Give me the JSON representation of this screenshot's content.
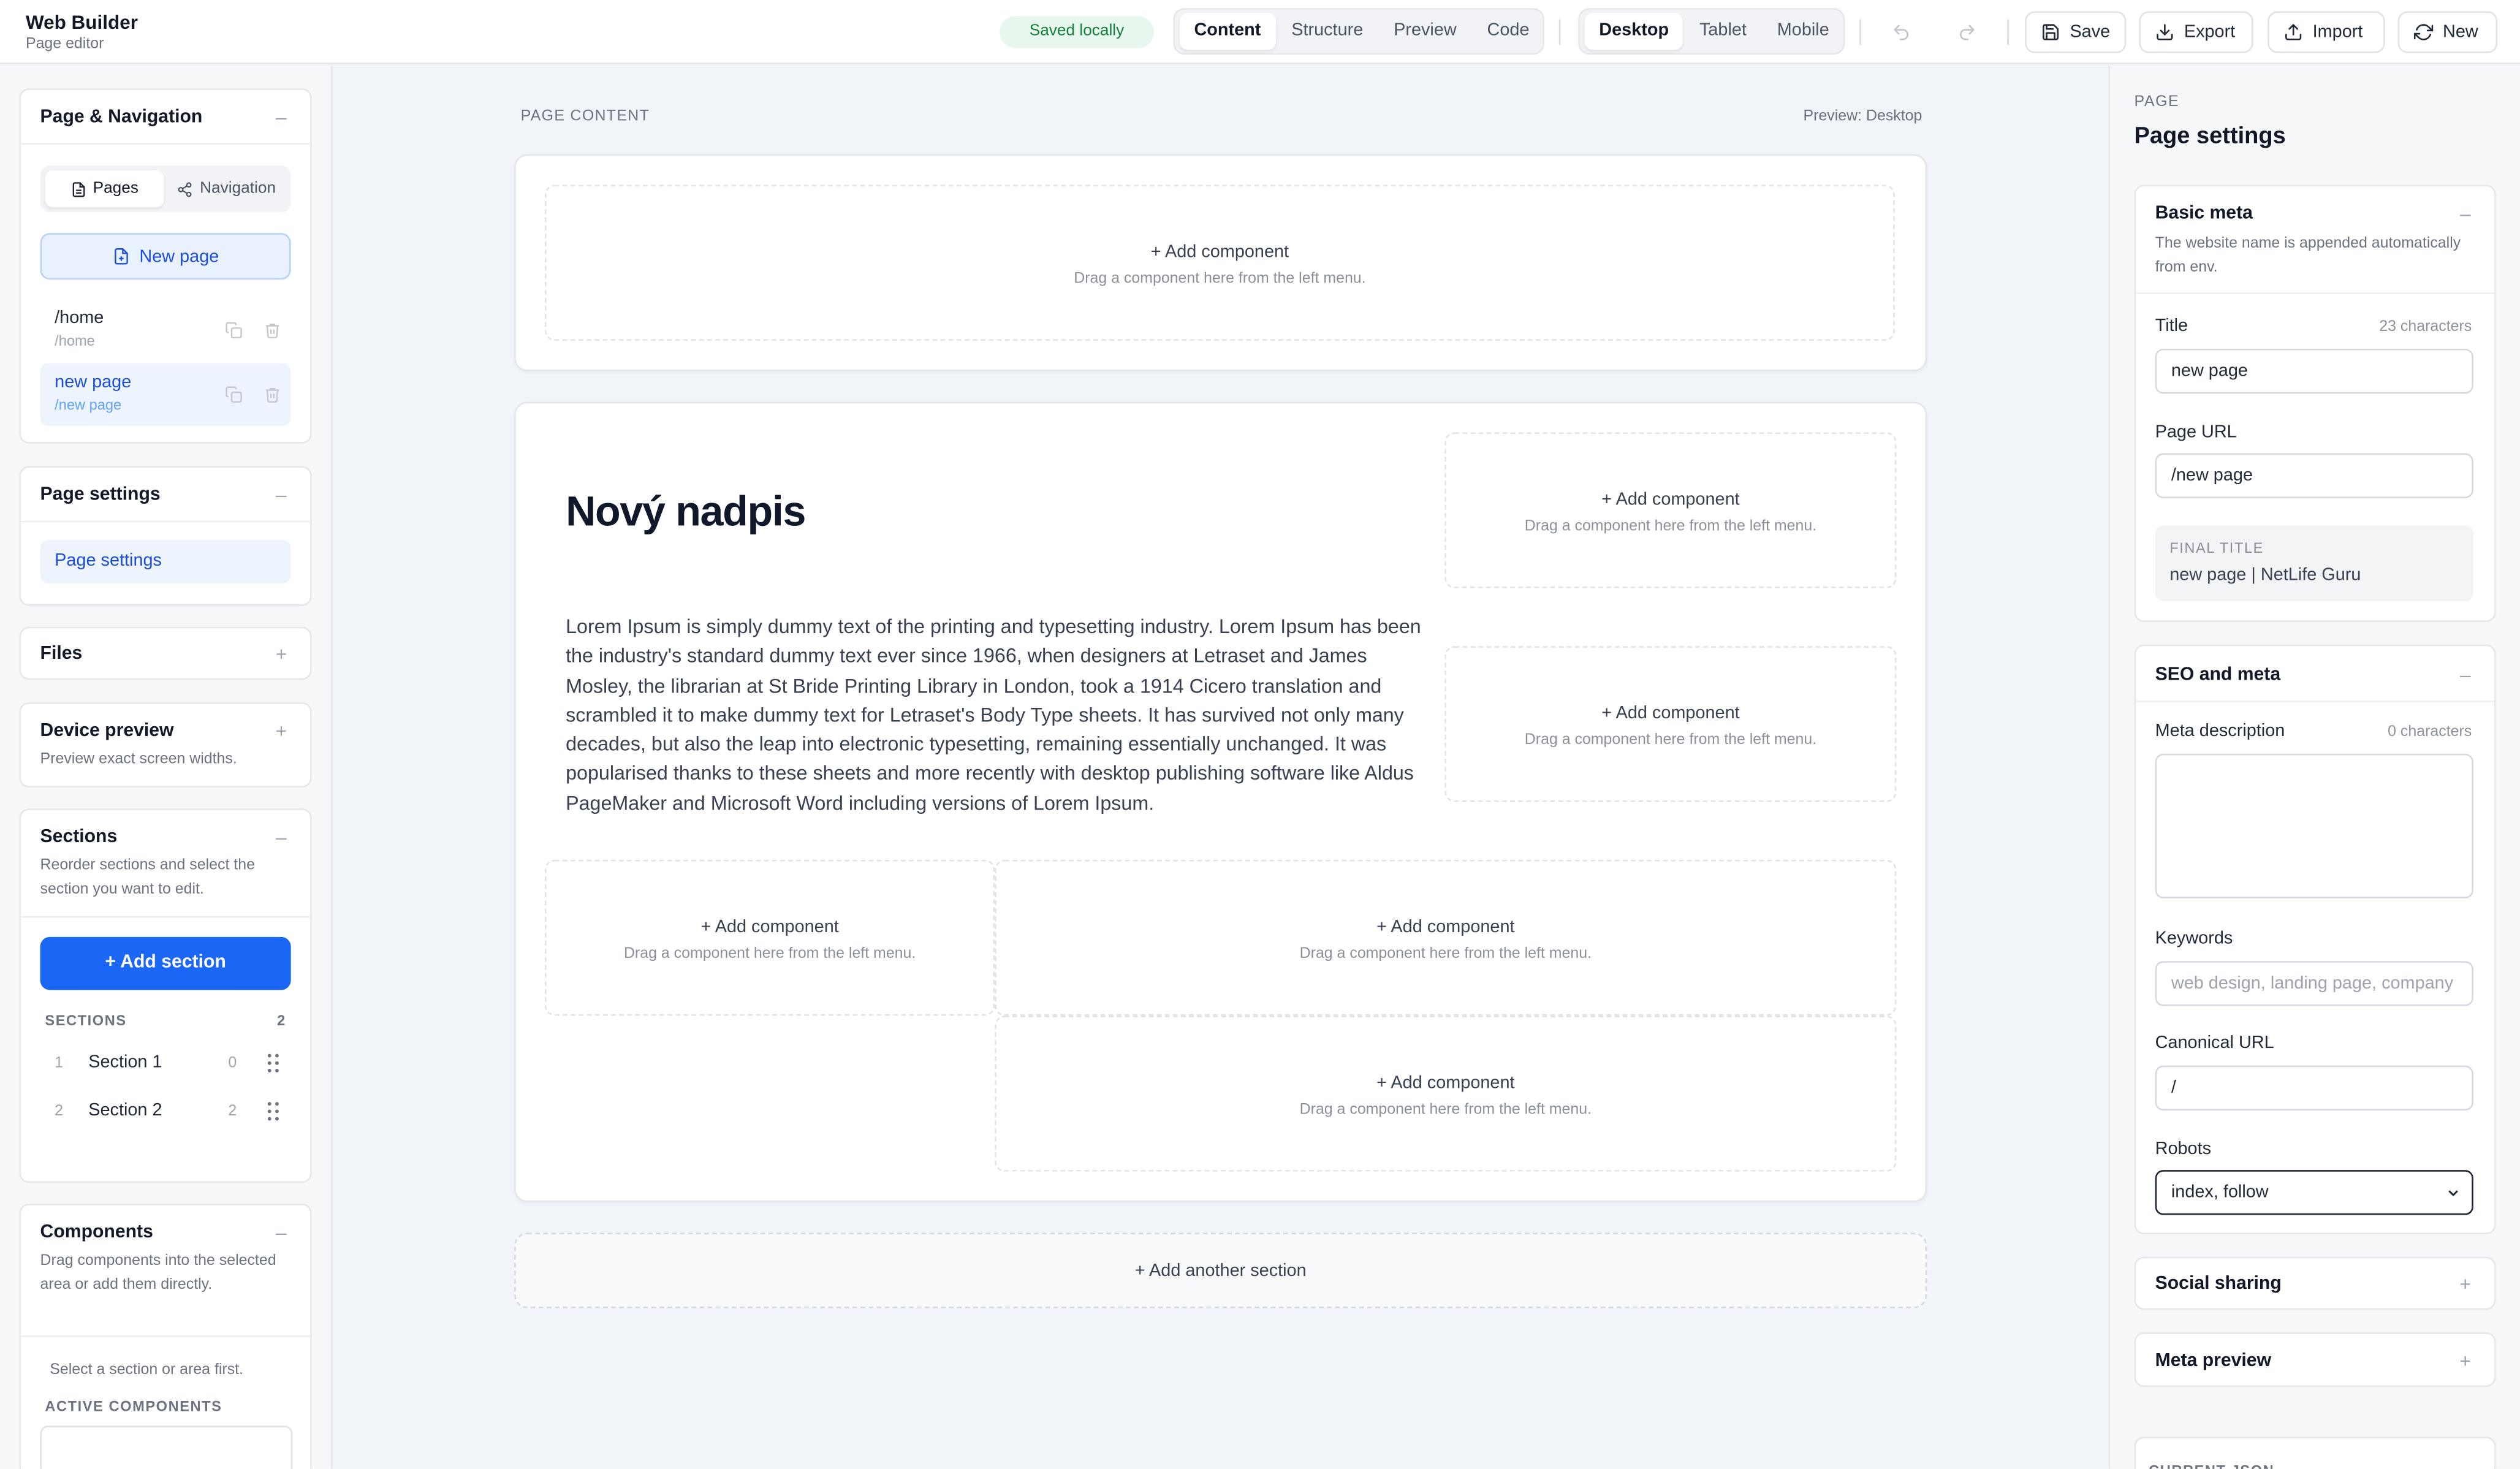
{
  "app": {
    "title": "Web Builder",
    "subtitle": "Page editor",
    "saved_status": "Saved locally"
  },
  "toolbar": {
    "mode_tabs": [
      {
        "label": "Content",
        "active": true
      },
      {
        "label": "Structure",
        "active": false
      },
      {
        "label": "Preview",
        "active": false
      },
      {
        "label": "Code",
        "active": false
      }
    ],
    "device_tabs": [
      {
        "label": "Desktop",
        "active": true
      },
      {
        "label": "Tablet",
        "active": false
      },
      {
        "label": "Mobile",
        "active": false
      }
    ],
    "save_label": "Save",
    "export_label": "Export",
    "import_label": "Import",
    "new_label": "New"
  },
  "sidebar": {
    "page_nav": {
      "title": "Page & Navigation",
      "toggle": "–",
      "tabs": [
        {
          "label": "Pages",
          "icon": "file-icon",
          "active": true
        },
        {
          "label": "Navigation",
          "icon": "share-icon",
          "active": false
        }
      ],
      "new_page_label": "New page",
      "pages": [
        {
          "name": "/home",
          "url": "/home",
          "active": false
        },
        {
          "name": "new page",
          "url": "/new page",
          "active": true
        }
      ]
    },
    "page_settings": {
      "title": "Page settings",
      "toggle": "–",
      "item_label": "Page settings"
    },
    "files": {
      "title": "Files",
      "toggle": "+"
    },
    "device_preview": {
      "title": "Device preview",
      "toggle": "+",
      "description": "Preview exact screen widths."
    },
    "sections": {
      "title": "Sections",
      "toggle": "–",
      "description": "Reorder sections and select the section you want to edit.",
      "add_label": "+ Add section",
      "list_header": "SECTIONS",
      "list_count": "2",
      "items": [
        {
          "index": "1",
          "name": "Section 1",
          "count": "0"
        },
        {
          "index": "2",
          "name": "Section 2",
          "count": "2"
        }
      ]
    },
    "components": {
      "title": "Components",
      "toggle": "–",
      "description": "Drag components into the selected area or add them directly.",
      "empty_hint": "Select a section or area first.",
      "active_header": "ACTIVE COMPONENTS"
    }
  },
  "canvas": {
    "header": "PAGE CONTENT",
    "preview_label": "Preview: Desktop",
    "dropzone_title": "+ Add component",
    "dropzone_hint": "Drag a component here from the left menu.",
    "heading": "Nový nadpis",
    "paragraph": "Lorem Ipsum is simply dummy text of the printing and typesetting industry. Lorem Ipsum has been the industry's standard dummy text ever since 1966, when designers at Letraset and James Mosley, the librarian at St Bride Printing Library in London, took a 1914 Cicero translation and scrambled it to make dummy text for Letraset's Body Type sheets. It has survived not only many decades, but also the leap into electronic typesetting, remaining essentially unchanged. It was popularised thanks to these sheets and more recently with desktop publishing software like Aldus PageMaker and Microsoft Word including versions of Lorem Ipsum.",
    "add_another_label": "+ Add another section"
  },
  "panel": {
    "kicker": "PAGE",
    "title": "Page settings",
    "basic_meta": {
      "title": "Basic meta",
      "toggle": "–",
      "description": "The website name is appended automatically from env.",
      "title_label": "Title",
      "title_hint": "23 characters",
      "title_value": "new page",
      "url_label": "Page URL",
      "url_value": "/new page",
      "final_title_label": "FINAL TITLE",
      "final_title_value": "new page | NetLife Guru"
    },
    "seo_meta": {
      "title": "SEO and meta",
      "toggle": "–",
      "description_label": "Meta description",
      "description_hint": "0 characters",
      "description_value": "",
      "keywords_label": "Keywords",
      "keywords_placeholder": "web design, landing page, company",
      "canonical_label": "Canonical URL",
      "canonical_value": "/",
      "robots_label": "Robots",
      "robots_value": "index, follow"
    },
    "social_sharing": {
      "title": "Social sharing",
      "toggle": "+"
    },
    "meta_preview": {
      "title": "Meta preview",
      "toggle": "+"
    },
    "current_json_label": "CURRENT JSON"
  }
}
